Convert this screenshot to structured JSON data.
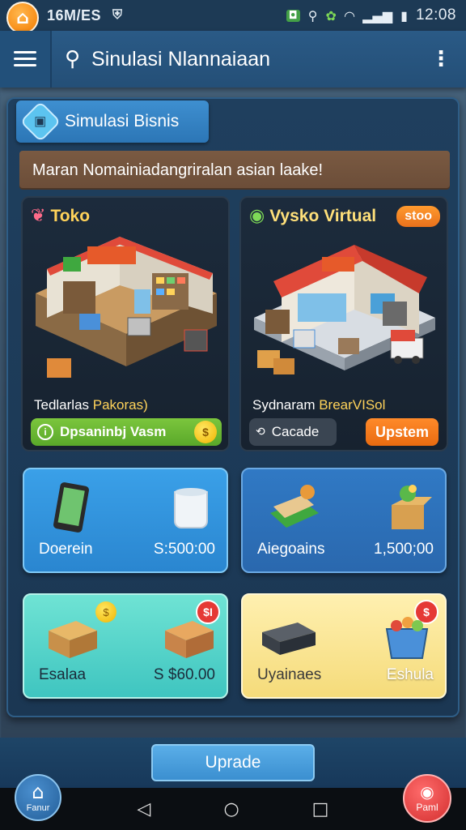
{
  "status_bar": {
    "carrier": "16M/ES",
    "time": "12:08",
    "icons": [
      "shield-icon",
      "notification-icon",
      "location-icon",
      "leaf-icon",
      "wifi-icon",
      "signal-icon",
      "battery-icon"
    ]
  },
  "app_bar": {
    "title": "Sinulasi Nlannaiaan",
    "menu_icon": "hamburger-icon",
    "search_icon": "search-icon",
    "more_icon": "more-vert-icon"
  },
  "panel": {
    "tab_label": "Simulasi Bisnis",
    "banner": "Maran Nomainiadangriralan asian laake!"
  },
  "features": [
    {
      "title": "Toko",
      "subtitle_plain": "Tedlarlas ",
      "subtitle_highlight": "Pakoras)",
      "button_label": "Dpsaninbj Vasm",
      "coin_symbol": "$"
    },
    {
      "title": "Vysko Virtual",
      "badge": "stoo",
      "subtitle_plain": "Sydnaram ",
      "subtitle_highlight": "BrearVISol",
      "secondary_button": "Cacade",
      "primary_button": "Upstem"
    }
  ],
  "items": [
    {
      "name": "Doerein",
      "price": "S:500:00"
    },
    {
      "name": "Aiegoains",
      "price": "1,500;00"
    },
    {
      "name": "Esalaa",
      "price": "S $60.00",
      "badge": "$I",
      "coin": "$"
    },
    {
      "name": "Uyainaes",
      "price": "Eshula",
      "badge": "$"
    }
  ],
  "bottom": {
    "upgrade_label": "Uprade",
    "home_label": "Fanur",
    "panel_label": "Paml"
  },
  "colors": {
    "app_bar": "#2a5a86",
    "accent_orange": "#e9711c",
    "accent_green": "#5aa82a",
    "title_yellow": "#ffd35a"
  }
}
